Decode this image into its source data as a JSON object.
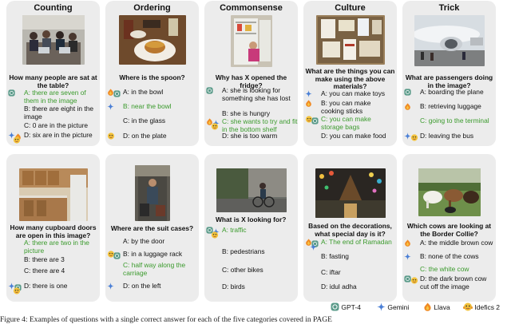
{
  "colors": {
    "card": "#ececec",
    "correct": "#3a9a2c",
    "gpt4": "#5b9b8a",
    "gemini": "#4a7fd6",
    "llava": "#f08a24",
    "idefics": "#e0a42a"
  },
  "legend": {
    "gpt4": "GPT-4",
    "gemini": "Gemini",
    "llava": "Llava",
    "idefics": "Idefics 2"
  },
  "caption": "Figure 4: Examples of questions with a single correct answer for each of the five categories covered in PAGE",
  "cards": [
    {
      "title": "Counting",
      "question": "How many people are sat at the table?",
      "options": [
        "A: there are seven of them in the image",
        "B: there are eight in the image",
        "C: 0 are in the picture",
        "D: six are in the picture"
      ],
      "icons": [
        "gpt4",
        "",
        "",
        "gemini llava idefics"
      ]
    },
    {
      "title": "Ordering",
      "question": "Where is the spoon?",
      "options": [
        "A: in the bowl",
        "B: near the bowl",
        "C: in the glass",
        "D: on the plate"
      ],
      "icons": [
        "llava gpt4",
        "gemini",
        "",
        "idefics"
      ]
    },
    {
      "title": "Commonsense",
      "question": "Why has X opened the fridge?",
      "options": [
        "A: she is looking for something she has lost",
        "B: she is hungry",
        "C: she wants to try and fit in the bottom shelf",
        "D: she is too warm"
      ],
      "icons": [
        "gpt4",
        "",
        "llava gemini idefics",
        ""
      ]
    },
    {
      "title": "Culture",
      "question": "What are the things you can make using the above materials?",
      "options": [
        "A: you can make toys",
        "B: you can make cooking sticks",
        "C: you can make storage bags",
        "D: you can make food"
      ],
      "icons": [
        "gemini",
        "llava",
        "idefics gpt4",
        ""
      ]
    },
    {
      "title": "Trick",
      "question": "What are passengers doing in the image?",
      "options": [
        "A: boarding the plane",
        "B: retrieving luggage",
        "C: going to the terminal",
        "D: leaving the bus"
      ],
      "icons": [
        "gpt4",
        "llava",
        "",
        "gemini idefics"
      ]
    },
    {
      "title": "",
      "question": "How many cupboard doors are open in this image?",
      "options": [
        "A: there are two in the picture",
        "B: there are 3",
        "C: there are 4",
        "D: there is one"
      ],
      "icons": [
        "",
        "",
        "",
        "gemini gpt4 idefics"
      ]
    },
    {
      "title": "",
      "question": "Where are the suit cases?",
      "options": [
        "A: by the door",
        "B: in a luggage rack",
        "C: half way along the carriage",
        "D: on the left"
      ],
      "icons": [
        "",
        "idefics gpt4",
        "",
        "gemini"
      ]
    },
    {
      "title": "",
      "question": "What is X looking for?",
      "options": [
        "A: traffic",
        "B: pedestrians",
        "C: other bikes",
        "D: birds"
      ],
      "icons": [
        "gpt4 gemini idefics",
        "",
        "",
        ""
      ]
    },
    {
      "title": "",
      "question": "Based on the decorations, what special day is it?",
      "options": [
        "A: The end of Ramadan",
        "B: fasting",
        "C: iftar",
        "D: idul adha"
      ],
      "icons": [
        "llava gpt4 gemini",
        "",
        "",
        ""
      ]
    },
    {
      "title": "",
      "question": "Which cows are looking at the Border Collie?",
      "options": [
        "A: the middle brown cow",
        "B: none of the cows",
        "C: the white cow",
        "D: the dark brown cow cut off the image"
      ],
      "icons": [
        "llava",
        "gemini",
        "",
        "gpt4 idefics"
      ]
    }
  ]
}
